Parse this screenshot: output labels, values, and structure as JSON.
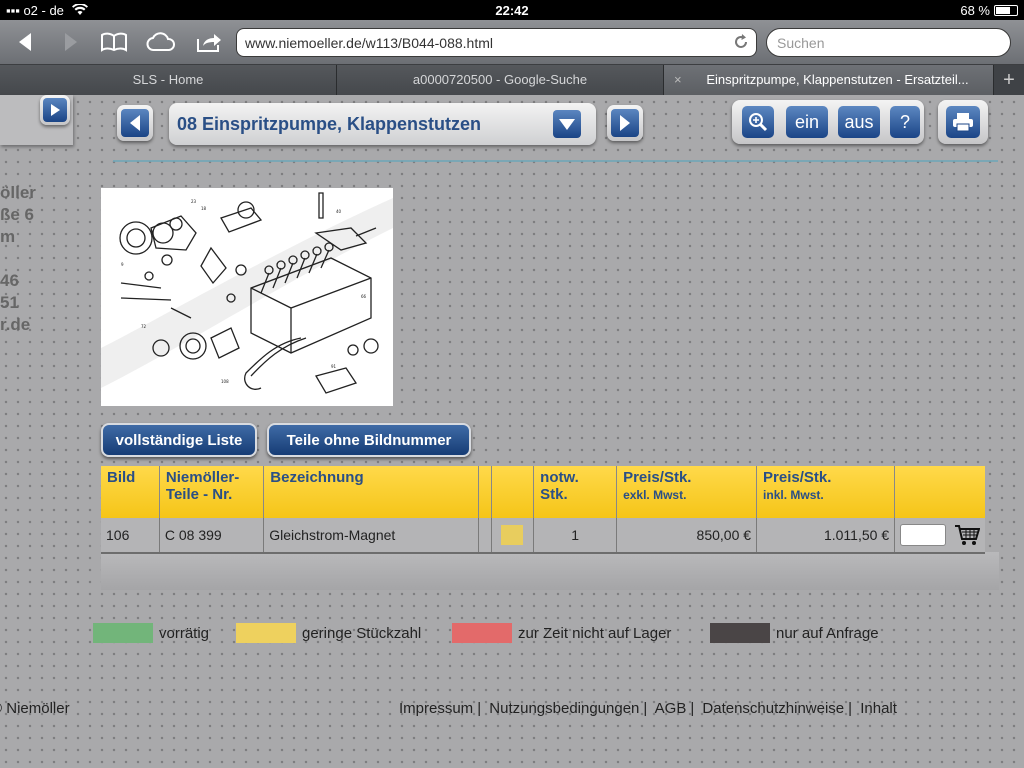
{
  "status": {
    "carrier": "o2 - de",
    "time": "22:42",
    "battery": "68 %",
    "battery_fraction": 0.68
  },
  "browser": {
    "url": "www.niemoeller.de/w113/B044-088.html",
    "search_placeholder": "Suchen",
    "tabs": [
      {
        "label": "SLS - Home"
      },
      {
        "label": "a0000720500 - Google-Suche"
      },
      {
        "label": "Einspritzpumpe, Klappenstutzen - Ersatzteil..."
      }
    ],
    "tab_close": "×",
    "newtab": "+"
  },
  "left": {
    "info": "öller\nße 6\nm\n\n46\n51\nr.de"
  },
  "nav": {
    "section_title": "08 Einspritzpumpe, Klappenstutzen",
    "zoom_in": "ein",
    "zoom_out": "aus",
    "help": "?"
  },
  "buttons": {
    "full_list": "vollständige Liste",
    "no_image_parts": "Teile ohne Bildnummer"
  },
  "table": {
    "headers": {
      "bild": "Bild",
      "teilenr_1": "Niemöller-",
      "teilenr_2": "Teile - Nr.",
      "bezeichnung": "Bezeichnung",
      "notw_1": "notw.",
      "notw_2": "Stk.",
      "preis_ex_1": "Preis/Stk.",
      "preis_ex_2": "exkl. Mwst.",
      "preis_in_1": "Preis/Stk.",
      "preis_in_2": "inkl. Mwst."
    },
    "rows": [
      {
        "bild": "106",
        "teilenr": "C 08 399",
        "bezeichnung": "Gleichstrom-Magnet",
        "status_color": "#e8cd5e",
        "stk": "1",
        "preis_exkl": "850,00 €",
        "preis_inkl": "1.011,50 €"
      }
    ]
  },
  "legend": [
    {
      "color": "#72b57a",
      "label": "vorrätig"
    },
    {
      "color": "#eed15e",
      "label": "geringe Stückzahl"
    },
    {
      "color": "#e36a6a",
      "label": "zur Zeit nicht auf Lager"
    },
    {
      "color": "#4a4546",
      "label": "nur auf Anfrage"
    }
  ],
  "footer": {
    "copyright": "Niemöller",
    "links": [
      "Impressum",
      "Nutzungsbedingungen",
      "AGB",
      "Datenschutzhinweise",
      "Inhalt"
    ]
  },
  "colors": {
    "brand_blue": "#2a4f86",
    "header_yellow": "#f5c518"
  }
}
